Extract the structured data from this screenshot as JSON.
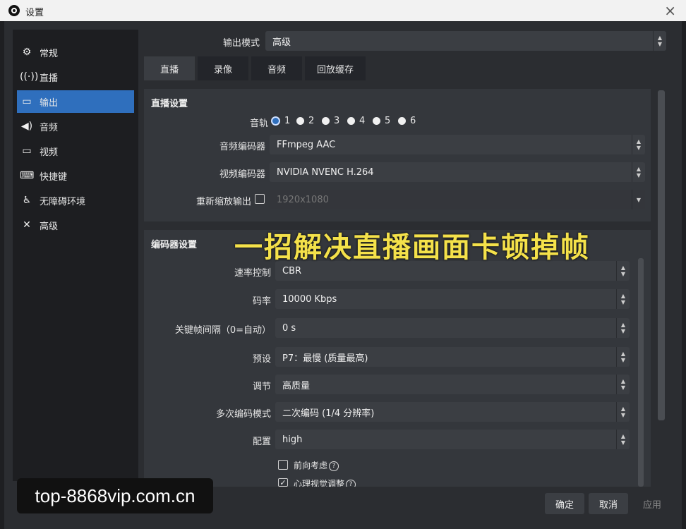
{
  "window": {
    "title": "设置",
    "close_label": "×"
  },
  "sidebar": {
    "items": [
      {
        "label": "常规",
        "icon": "gear-icon",
        "glyph": "⚙"
      },
      {
        "label": "直播",
        "icon": "broadcast-icon",
        "glyph": "📡"
      },
      {
        "label": "输出",
        "icon": "output-icon",
        "glyph": "▭"
      },
      {
        "label": "音频",
        "icon": "speaker-icon",
        "glyph": "🔊"
      },
      {
        "label": "视频",
        "icon": "monitor-icon",
        "glyph": "▭"
      },
      {
        "label": "快捷键",
        "icon": "keyboard-icon",
        "glyph": "⌨"
      },
      {
        "label": "无障碍环境",
        "icon": "accessibility-icon",
        "glyph": "♿"
      },
      {
        "label": "高级",
        "icon": "tools-icon",
        "glyph": "✕"
      }
    ],
    "active_index": 2
  },
  "output_mode": {
    "label": "输出模式",
    "value": "高级"
  },
  "tabs": [
    "直播",
    "录像",
    "音频",
    "回放缓存"
  ],
  "stream_settings": {
    "title": "直播设置",
    "audio_track": {
      "label": "音轨",
      "options": [
        "1",
        "2",
        "3",
        "4",
        "5",
        "6"
      ],
      "selected": "1"
    },
    "audio_encoder": {
      "label": "音频编码器",
      "value": "FFmpeg AAC"
    },
    "video_encoder": {
      "label": "视频编码器",
      "value": "NVIDIA NVENC H.264"
    },
    "rescale": {
      "label": "重新缩放输出",
      "checked": false,
      "value": "1920x1080"
    }
  },
  "encoder_settings": {
    "title": "编码器设置",
    "rate_control": {
      "label": "速率控制",
      "value": "CBR"
    },
    "bitrate": {
      "label": "码率",
      "value": "10000 Kbps"
    },
    "keyframe": {
      "label": "关键帧间隔（0=自动）",
      "value": "0 s"
    },
    "preset": {
      "label": "预设",
      "value": "P7：最慢 (质量最高)"
    },
    "tuning": {
      "label": "调节",
      "value": "高质量"
    },
    "multipass": {
      "label": "多次编码模式",
      "value": "二次编码 (1/4 分辨率)"
    },
    "profile": {
      "label": "配置",
      "value": "high"
    },
    "lookahead": {
      "label": "前向考虑",
      "checked": false
    },
    "psycho": {
      "label": "心理视觉调整",
      "checked": true
    }
  },
  "overlay_caption": "一招解决直播画面卡顿掉帧",
  "watermark": "top-8868vip.com.cn",
  "buttons": {
    "ok": "确定",
    "cancel": "取消",
    "apply": "应用"
  }
}
